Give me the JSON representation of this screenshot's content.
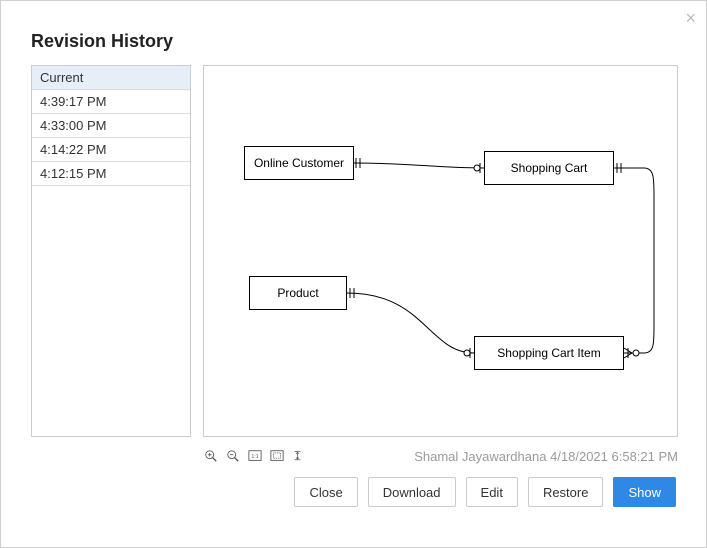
{
  "dialog": {
    "title": "Revision History",
    "close_glyph": "×"
  },
  "revisions": {
    "items": [
      {
        "label": "Current",
        "selected": true
      },
      {
        "label": "4:39:17 PM",
        "selected": false
      },
      {
        "label": "4:33:00 PM",
        "selected": false
      },
      {
        "label": "4:14:22 PM",
        "selected": false
      },
      {
        "label": "4:12:15 PM",
        "selected": false
      }
    ]
  },
  "diagram": {
    "entities": {
      "online_customer": "Online Customer",
      "shopping_cart": "Shopping Cart",
      "product": "Product",
      "shopping_cart_item": "Shopping Cart Item"
    }
  },
  "toolbar": {
    "zoom_in": "zoom-in",
    "zoom_out": "zoom-out",
    "zoom_actual": "zoom-1-1",
    "fit_page": "fit-page",
    "fit_height": "fit-height"
  },
  "meta": {
    "author": "Shamal Jayawardhana",
    "timestamp": "4/18/2021 6:58:21 PM"
  },
  "buttons": {
    "close": "Close",
    "download": "Download",
    "edit": "Edit",
    "restore": "Restore",
    "show": "Show"
  }
}
